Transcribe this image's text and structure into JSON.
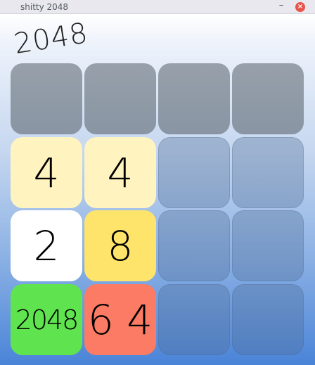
{
  "window": {
    "title": "shitty 2048",
    "minimize_label": "–",
    "close_label": "×"
  },
  "header": {
    "logo": "2048"
  },
  "board": {
    "rows": [
      [
        {
          "value": "",
          "color": "#9aa2ab"
        },
        {
          "value": "",
          "color": "#9aa2ab"
        },
        {
          "value": "",
          "color": "#9aa2ab"
        },
        {
          "value": "",
          "color": "#9aa2ab"
        }
      ],
      [
        {
          "value": "4",
          "color": "#fff3bf"
        },
        {
          "value": "4",
          "color": "#fff3bf"
        },
        {
          "value": "",
          "color": ""
        },
        {
          "value": "",
          "color": ""
        }
      ],
      [
        {
          "value": "2",
          "color": "#ffffff"
        },
        {
          "value": "8",
          "color": "#ffe46b"
        },
        {
          "value": "",
          "color": ""
        },
        {
          "value": "",
          "color": ""
        }
      ],
      [
        {
          "value": "2048",
          "color": "#5fe34e"
        },
        {
          "value": "6 4",
          "color": "#fb7b64"
        },
        {
          "value": "",
          "color": ""
        },
        {
          "value": "",
          "color": ""
        }
      ]
    ]
  }
}
